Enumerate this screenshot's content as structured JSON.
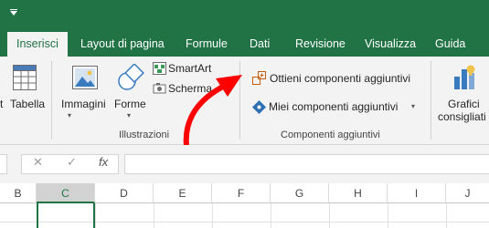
{
  "qat": {
    "icon": "customize-qat-icon"
  },
  "tabs": [
    {
      "label": "Inserisci",
      "active": true
    },
    {
      "label": "Layout di pagina"
    },
    {
      "label": "Formule"
    },
    {
      "label": "Dati"
    },
    {
      "label": "Revisione"
    },
    {
      "label": "Visualizza"
    },
    {
      "label": "Guida"
    }
  ],
  "ribbon": {
    "tables": {
      "partial_label": "t",
      "table_label": "Tabella"
    },
    "illustrations": {
      "images_label": "Immagini",
      "shapes_label": "Forme",
      "smartart_label": "SmartArt",
      "screenshot_label": "Scherma",
      "group_label": "Illustrazioni"
    },
    "addins": {
      "get_addins_label": "Ottieni componenti aggiuntivi",
      "my_addins_label": "Miei componenti aggiuntivi",
      "group_label": "Componenti aggiuntivi"
    },
    "charts": {
      "recommended_line1": "Grafici",
      "recommended_line2": "consigliati"
    }
  },
  "formula_bar": {
    "cancel_symbol": "✕",
    "enter_symbol": "✓",
    "fx_label": "fx",
    "value": ""
  },
  "columns": [
    "B",
    "C",
    "D",
    "E",
    "F",
    "G",
    "H",
    "I",
    "J"
  ],
  "selected_column": "C",
  "annotation": {
    "arrow_color": "#ff0000"
  },
  "colors": {
    "brand": "#217346",
    "ribbon_bg": "#f3f3f3"
  }
}
